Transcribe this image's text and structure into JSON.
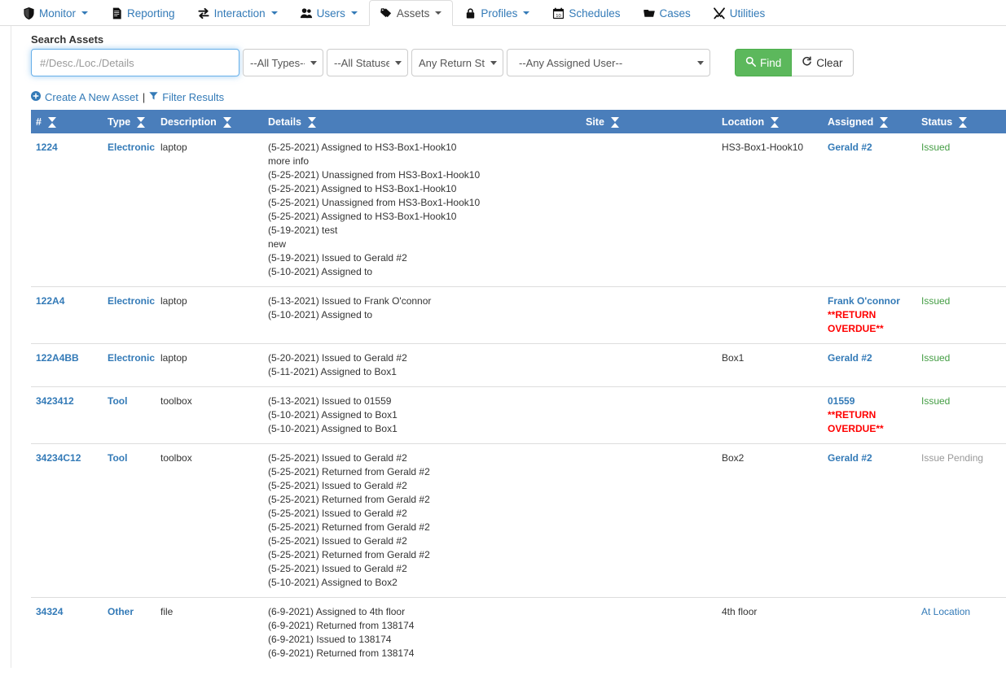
{
  "nav": {
    "items": [
      {
        "label": "Monitor",
        "icon": "shield-icon",
        "caret": true,
        "active": false
      },
      {
        "label": "Reporting",
        "icon": "report-icon",
        "caret": false,
        "active": false
      },
      {
        "label": "Interaction",
        "icon": "exchange-icon",
        "caret": true,
        "active": false
      },
      {
        "label": "Users",
        "icon": "users-icon",
        "caret": true,
        "active": false
      },
      {
        "label": "Assets",
        "icon": "tag-icon",
        "caret": true,
        "active": true
      },
      {
        "label": "Profiles",
        "icon": "lock-icon",
        "caret": true,
        "active": false
      },
      {
        "label": "Schedules",
        "icon": "calendar-icon",
        "caret": false,
        "active": false
      },
      {
        "label": "Cases",
        "icon": "folder-icon",
        "caret": false,
        "active": false
      },
      {
        "label": "Utilities",
        "icon": "wrench-tools-icon",
        "caret": false,
        "active": false
      }
    ]
  },
  "search": {
    "heading": "Search Assets",
    "input_placeholder": "#/Desc./Loc./Details",
    "input_value": "",
    "type_select": "--All Types--",
    "status_select": "--All Statuses--",
    "return_select": "Any Return Status",
    "user_select": "--Any Assigned User--",
    "find_label": "Find",
    "clear_label": "Clear"
  },
  "actions": {
    "create_label": "Create A New Asset",
    "separator": "|",
    "filter_label": "Filter Results"
  },
  "table": {
    "columns": [
      {
        "label": "#"
      },
      {
        "label": "Type"
      },
      {
        "label": "Description"
      },
      {
        "label": "Details"
      },
      {
        "label": "Site"
      },
      {
        "label": "Location"
      },
      {
        "label": "Assigned"
      },
      {
        "label": "Status"
      }
    ],
    "rows": [
      {
        "num": "1224",
        "type": "Electronic",
        "description": "laptop",
        "details": [
          "(5-25-2021) Assigned to HS3-Box1-Hook10",
          "more info",
          "(5-25-2021) Unassigned from HS3-Box1-Hook10",
          "(5-25-2021) Assigned to HS3-Box1-Hook10",
          "(5-25-2021) Unassigned from HS3-Box1-Hook10",
          "(5-25-2021) Assigned to HS3-Box1-Hook10",
          "(5-19-2021) test",
          "new",
          "(5-19-2021) Issued to Gerald #2",
          "(5-10-2021) Assigned to"
        ],
        "site": "",
        "location": "HS3-Box1-Hook10",
        "assigned": "Gerald #2",
        "assigned_note": "",
        "status": "Issued",
        "status_kind": "issued"
      },
      {
        "num": "122A4",
        "type": "Electronic",
        "description": "laptop",
        "details": [
          "(5-13-2021) Issued to Frank O'connor",
          "(5-10-2021) Assigned to"
        ],
        "site": "",
        "location": "",
        "assigned": "Frank O'connor",
        "assigned_note": "**RETURN OVERDUE**",
        "status": "Issued",
        "status_kind": "issued"
      },
      {
        "num": "122A4BB",
        "type": "Electronic",
        "description": "laptop",
        "details": [
          "(5-20-2021) Issued to Gerald #2",
          "(5-11-2021) Assigned to Box1"
        ],
        "site": "",
        "location": "Box1",
        "assigned": "Gerald #2",
        "assigned_note": "",
        "status": "Issued",
        "status_kind": "issued"
      },
      {
        "num": "3423412",
        "type": "Tool",
        "description": "toolbox",
        "details": [
          "(5-13-2021) Issued to 01559",
          "(5-10-2021) Assigned to Box1",
          "(5-10-2021) Assigned to Box1"
        ],
        "site": "",
        "location": "",
        "assigned": "01559",
        "assigned_note": "**RETURN OVERDUE**",
        "status": "Issued",
        "status_kind": "issued"
      },
      {
        "num": "34234C12",
        "type": "Tool",
        "description": "toolbox",
        "details": [
          "(5-25-2021) Issued to Gerald #2",
          "(5-25-2021) Returned from Gerald #2",
          "(5-25-2021) Issued to Gerald #2",
          "(5-25-2021) Returned from Gerald #2",
          "(5-25-2021) Issued to Gerald #2",
          "(5-25-2021) Returned from Gerald #2",
          "(5-25-2021) Issued to Gerald #2",
          "(5-25-2021) Returned from Gerald #2",
          "(5-25-2021) Issued to Gerald #2",
          "(5-10-2021) Assigned to Box2"
        ],
        "site": "",
        "location": "Box2",
        "assigned": "Gerald #2",
        "assigned_note": "",
        "status": "Issue Pending",
        "status_kind": "pending"
      },
      {
        "num": "34324",
        "type": "Other",
        "description": "file",
        "details": [
          "(6-9-2021) Assigned to 4th floor",
          "(6-9-2021) Returned from 138174",
          "(6-9-2021) Issued to 138174",
          "(6-9-2021) Returned from 138174"
        ],
        "site": "",
        "location": "4th floor",
        "assigned": "",
        "assigned_note": "",
        "status": "At Location",
        "status_kind": "atlocation"
      }
    ]
  },
  "colors": {
    "header_blue": "#4a7ebb",
    "link_blue": "#337ab7",
    "issued_green": "#449d44",
    "overdue_red": "#ff0000",
    "pending_gray": "#999999",
    "find_green": "#5cb85c"
  }
}
